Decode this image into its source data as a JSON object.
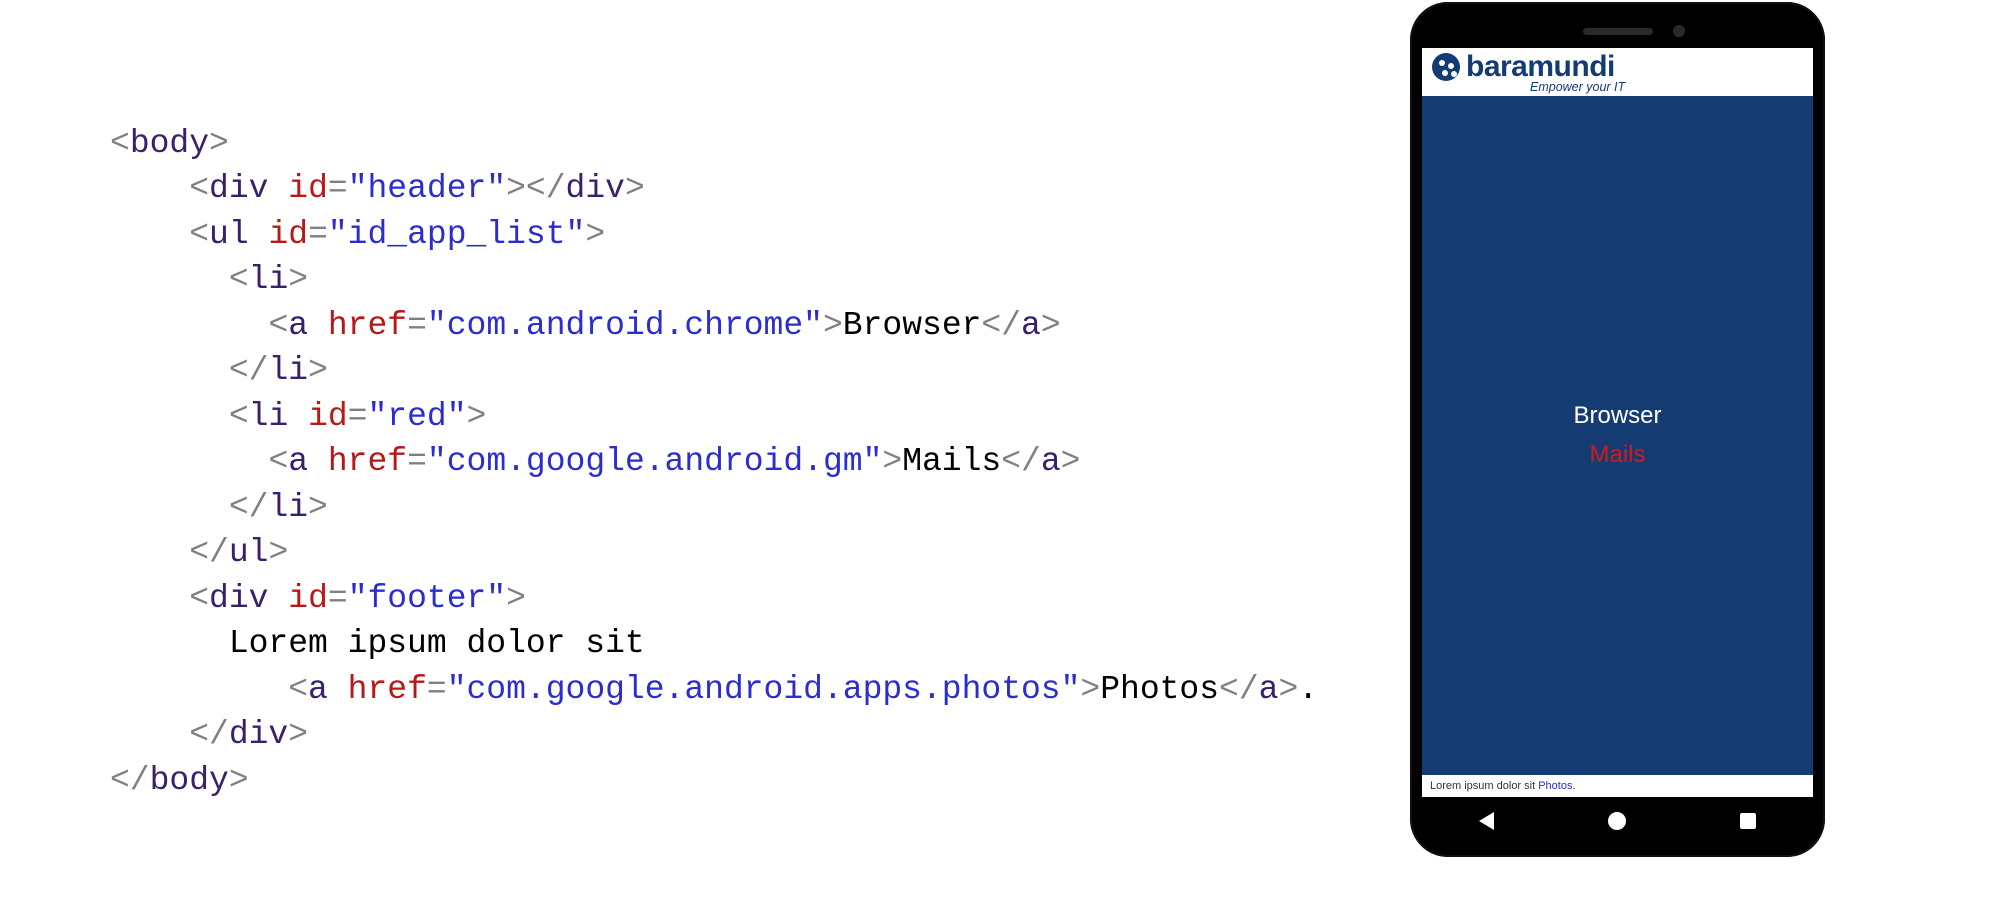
{
  "code": {
    "body_open": "body",
    "div": "div",
    "ul": "ul",
    "li": "li",
    "a": "a",
    "id_key": "id",
    "href_key": "href",
    "header_id": "\"header\"",
    "applist_id": "\"id_app_list\"",
    "red_id": "\"red\"",
    "footer_id": "\"footer\"",
    "href_chrome": "\"com.android.chrome\"",
    "href_gmail": "\"com.google.android.gm\"",
    "href_photos": "\"com.google.android.apps.photos\"",
    "txt_browser": "Browser",
    "txt_mails": "Mails",
    "txt_lorem": "Lorem ipsum dolor sit",
    "txt_photos": "Photos",
    "dot": "."
  },
  "phone": {
    "brand_name": "baramundi",
    "brand_tag": "Empower your IT",
    "items": {
      "browser": "Browser",
      "mails": "Mails"
    },
    "footer_text": "Lorem ipsum dolor sit ",
    "footer_link": "Photos",
    "footer_dot": "."
  }
}
